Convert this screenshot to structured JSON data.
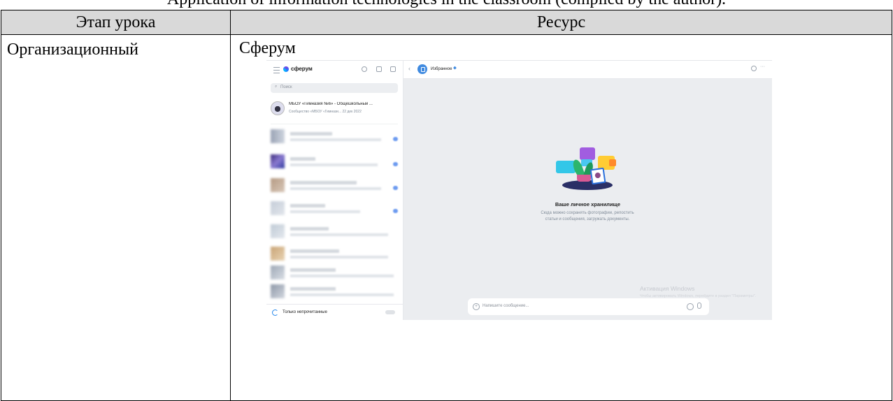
{
  "caption": "Application of information technologies in the classroom (compiled by the author).",
  "table": {
    "headers": [
      "Этап урока",
      "Ресурс"
    ],
    "row": {
      "stage": "Организационный",
      "resource": "Сферум"
    }
  },
  "screenshot": {
    "logo_text": "сферум",
    "search_placeholder": "Поиск",
    "pinned_chat": {
      "title": "МБОУ «Гимназия №6» - Общешкольный ...",
      "subtitle": "Сообщество «МБОУ «Гимнази... 22 дек 2022"
    },
    "unread_only_label": "Только непрочитанные",
    "chat_title": "Избранное",
    "empty_title": "Ваше личное хранилище",
    "empty_text": "Сюда можно сохранять фотографии, репостить статьи и сообщения, загружать документы.",
    "composer_placeholder": "Напишите сообщение...",
    "watermark_title": "Активация Windows",
    "watermark_text": "Чтобы активировать Windows, перейдите в раздел \"Параметры\"."
  },
  "colors": {
    "header_bg": "#d9d9d9",
    "accent": "#3f8ae0",
    "chat_bg": "#ebedf0"
  }
}
